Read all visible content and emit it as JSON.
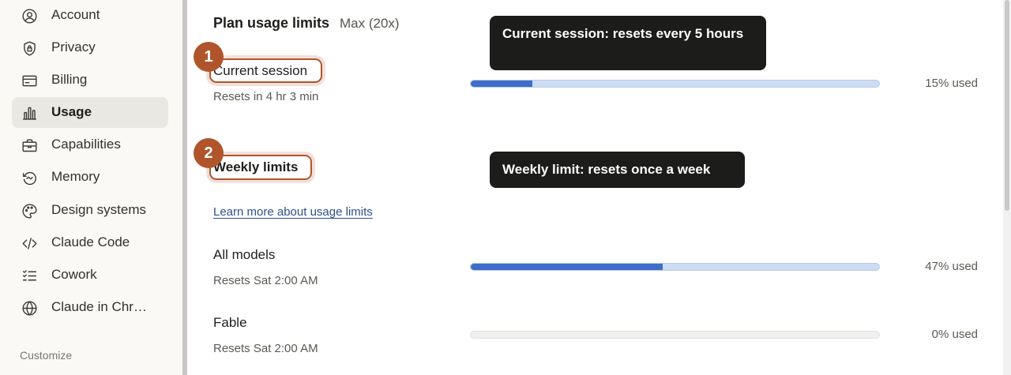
{
  "sidebar": {
    "items": [
      {
        "label": "Account",
        "icon": "account-icon"
      },
      {
        "label": "Privacy",
        "icon": "privacy-shield-icon"
      },
      {
        "label": "Billing",
        "icon": "billing-card-icon"
      },
      {
        "label": "Usage",
        "icon": "usage-bar-chart-icon",
        "active": true
      },
      {
        "label": "Capabilities",
        "icon": "capabilities-briefcase-icon"
      },
      {
        "label": "Memory",
        "icon": "memory-icon"
      },
      {
        "label": "Design systems",
        "icon": "design-palette-icon"
      },
      {
        "label": "Claude Code",
        "icon": "code-icon"
      },
      {
        "label": "Cowork",
        "icon": "cowork-checklist-icon"
      },
      {
        "label": "Claude in Chr…",
        "icon": "globe-icon"
      }
    ],
    "section_label": "Customize"
  },
  "main": {
    "heading": "Plan usage limits",
    "plan": "Max (20x)",
    "current_session": {
      "title": "Current session",
      "sub": "Resets in 4 hr 3 min",
      "percent_used": 15,
      "percent_label": "15% used"
    },
    "weekly": {
      "title": "Weekly limits",
      "learn_more": "Learn more about usage limits",
      "rows": [
        {
          "title": "All models",
          "sub": "Resets Sat 2:00 AM",
          "percent_used": 47,
          "percent_label": "47% used"
        },
        {
          "title": "Fable",
          "sub": "Resets Sat 2:00 AM",
          "percent_used": 0,
          "percent_label": "0% used"
        }
      ]
    }
  },
  "annotations": {
    "badge_1": "1",
    "badge_2": "2",
    "tooltip_1": "Current session: resets every 5 hours",
    "tooltip_2": "Weekly limit: resets once a week"
  },
  "colors": {
    "accent_orange": "#b0552b",
    "bar_fill": "#3e6ec8",
    "bar_track": "#ccdcf3",
    "tooltip_bg": "#1c1c1b"
  }
}
